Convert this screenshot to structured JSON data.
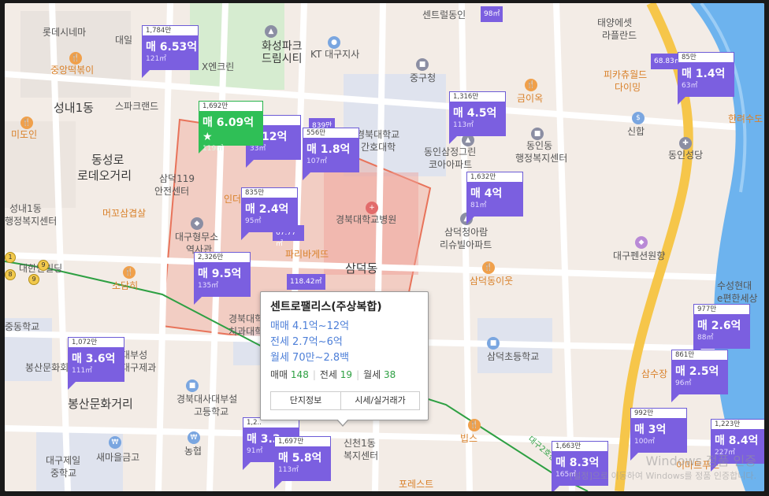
{
  "map_labels": {
    "lotte_cinema": "롯데시네마",
    "daeil": "대일",
    "hwaseong_park": "화성파크",
    "dream_city": "드림시티",
    "kt_daegu": "KT 대구지사",
    "centrum": "센트럴동인",
    "taeyang": "태양에셋",
    "la_plande": "라플란드",
    "jungang_tteok": "중앙떡볶이",
    "xscreen": "X엔크린",
    "jungguchung": "중구청",
    "pikachu": "피카츄월드",
    "daiming": "다이밍",
    "seongnae1": "성내1동",
    "spacland": "스파크랜드",
    "geumi": "금이옥",
    "gyeongbuk_uni": "경북대학교",
    "nursing": "간호대학",
    "dongin_samjeong": "동인삼정그린",
    "korea_apt": "코아아파트",
    "dongin_admin": "동인동",
    "dongin_admin2": "행정복지센터",
    "sinheung": "신합",
    "donginsangdang": "동인성당",
    "hanryeo": "한려수도",
    "midoin": "미도인",
    "dongseongro": "동성로",
    "rodeo": "로데오거리",
    "samdeok119": "삼덕119",
    "safety": "안전센터",
    "indoor": "인더",
    "gyeongbuk_hospital": "경북대학교병원",
    "samdeok_arum": "삼덕청아람",
    "river_apt": "리슈빌아파트",
    "daegu_penshion": "대구펜션원향",
    "seongnae_admin1": "성내1동",
    "seongnae_admin2": "행정복지센터",
    "mokko": "머꼬삼겹살",
    "daegu_hyeongmuso": "대구형무소",
    "history_hall": "역사관",
    "paris": "파리바게뜨",
    "samdeokdong": "삼덕동",
    "samdeok_eoyi": "삼덕동이웃",
    "sojeungi": "소담히",
    "hantin": "대한민빌딩",
    "suseong_hyundai": "수성현대",
    "e_pyeonhan": "e편한세상",
    "gyeongbuk_dental": "경북대학교",
    "dental": "치과대학",
    "school1": "중동학교",
    "bongsan_culture": "봉산문화회관",
    "daebuk": "대부성",
    "daebuk2": "대구제과",
    "samdeok_elem": "삼덕초등학교",
    "samsu": "삼수장",
    "bongsan_culture_street": "봉산문화거리",
    "gyeongbuk_highschool1": "경북대사대부설",
    "gyeongbuk_highschool2": "고등학교",
    "bips": "빕스",
    "daegu_jeil": "대구제일",
    "middle_school": "중학교",
    "saemaeul": "새마을금고",
    "nonghyup": "농협",
    "sindong": "신천1동",
    "welfare": "복지센터",
    "pore": "포레스트",
    "emart": "이마트푸드",
    "daegu_2hoseon": "대구2호선",
    "samdeok_apt_label": "삼덕",
    "seongnae1_label2": "성내1동"
  },
  "markers": [
    {
      "id": "m1",
      "price_per": "1,784만",
      "price": "매 6.53억",
      "area": "121㎡",
      "selected": false
    },
    {
      "id": "m2",
      "price_per": "1,692만",
      "price": "매 6.09억 ★",
      "area": "119㎡",
      "selected": true
    },
    {
      "id": "m3",
      "price_per": "",
      "price": "1.12억",
      "area": "33㎡",
      "selected": false
    },
    {
      "id": "m4",
      "price_per": "556만",
      "price": "매 1.8억",
      "area": "107㎡",
      "selected": false
    },
    {
      "id": "m5",
      "price_per": "1,316만",
      "price": "매 4.5억",
      "area": "113㎡",
      "selected": false
    },
    {
      "id": "m6",
      "price_per": "1,632만",
      "price": "매 4억",
      "area": "81㎡",
      "selected": false
    },
    {
      "id": "m7",
      "price_per": "835만",
      "price": "매 2.4억",
      "area": "95㎡",
      "selected": false
    },
    {
      "id": "m8",
      "price_per": "2,326만",
      "price": "매 9.5억",
      "area": "135㎡",
      "selected": false
    },
    {
      "id": "m9",
      "price_per": "1,072만",
      "price": "매 3.6억",
      "area": "111㎡",
      "selected": false
    },
    {
      "id": "m10",
      "price_per": "977만",
      "price": "매 2.6억",
      "area": "88㎡",
      "selected": false
    },
    {
      "id": "m11",
      "price_per": "861만",
      "price": "매 2.5억",
      "area": "96㎡",
      "selected": false
    },
    {
      "id": "m12",
      "price_per": "992만",
      "price": "매 3억",
      "area": "100㎡",
      "selected": false
    },
    {
      "id": "m13",
      "price_per": "1,223만",
      "price": "매 8.4억",
      "area": "227㎡",
      "selected": false
    },
    {
      "id": "m14",
      "price_per": "1,663만",
      "price": "매 8.3억",
      "area": "165㎡",
      "selected": false
    },
    {
      "id": "m15",
      "price_per": "1,697만",
      "price": "매 5.8억",
      "area": "113㎡",
      "selected": false
    },
    {
      "id": "m16",
      "price_per": "1,2..",
      "price": "매 3.3",
      "area": "91㎡",
      "selected": false
    },
    {
      "id": "m17",
      "price_per": "85만",
      "price": "매 1.4억",
      "area": "63㎡",
      "selected": false
    }
  ],
  "mini_markers": {
    "a": "839만",
    "b": "68.83㎡",
    "c": "67.77㎡",
    "d": "118.42㎡",
    "e": "98㎡"
  },
  "popup": {
    "name": "센트로팰리스(주상복합)",
    "sale": "매매 4.1억~12억",
    "jeonse": "전세 2.7억~6억",
    "monthly": "월세 70만~2.8백",
    "count_sale_label": "매매",
    "count_sale": "148",
    "count_jeonse_label": "전세",
    "count_jeonse": "19",
    "count_monthly_label": "월세",
    "count_monthly": "38",
    "btn_info": "단지정보",
    "btn_price": "시세/실거래가"
  },
  "subway": {
    "l1": "1",
    "l2": "8",
    "l3": "9",
    "l4": "9"
  },
  "watermark": {
    "line1": "Windows 정품 인증",
    "line2": "[설정]으로 이동하여 Windows를 정품 인증합니다."
  },
  "colors": {
    "marker": "#7b5fe0",
    "marker_selected": "#2fbf56",
    "boundary": "#e8735a",
    "river": "#6db3ee",
    "road_major": "#f6c64a",
    "subway_line": "#2ea043"
  }
}
